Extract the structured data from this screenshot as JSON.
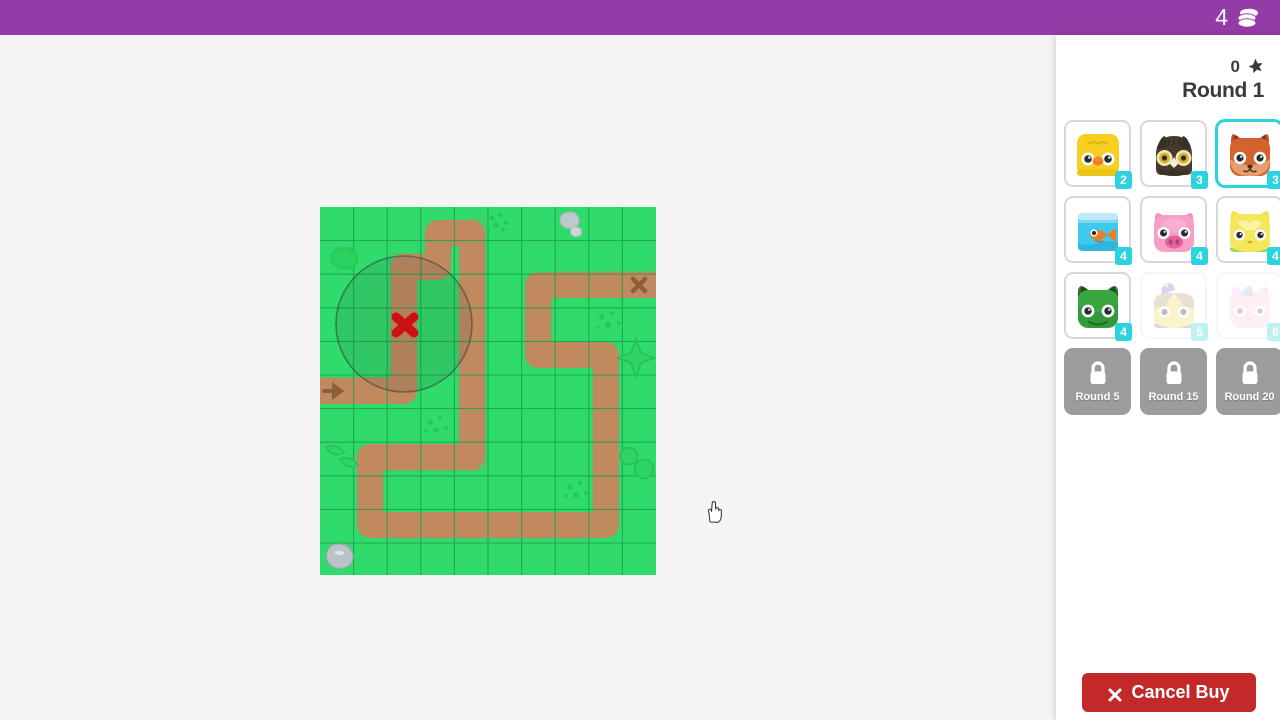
{
  "topbar": {
    "coins": "4",
    "coin_icon": "coin-stack-icon"
  },
  "sidebar": {
    "score": "0",
    "score_icon": "star-icon",
    "round_label": "Round 1",
    "towers": [
      {
        "name": "chick",
        "cost": "2",
        "selected": false,
        "affordable": true,
        "locked": false
      },
      {
        "name": "owl",
        "cost": "3",
        "selected": false,
        "affordable": true,
        "locked": false
      },
      {
        "name": "fox",
        "cost": "3",
        "selected": true,
        "affordable": true,
        "locked": false
      },
      {
        "name": "fish",
        "cost": "4",
        "selected": false,
        "affordable": true,
        "locked": false
      },
      {
        "name": "pig",
        "cost": "4",
        "selected": false,
        "affordable": true,
        "locked": false
      },
      {
        "name": "cat",
        "cost": "4",
        "selected": false,
        "affordable": true,
        "locked": false
      },
      {
        "name": "frog",
        "cost": "4",
        "selected": false,
        "affordable": true,
        "locked": false
      },
      {
        "name": "wizard",
        "cost": "5",
        "selected": false,
        "affordable": false,
        "locked": false
      },
      {
        "name": "unicorn",
        "cost": "6",
        "selected": false,
        "affordable": false,
        "locked": false
      }
    ],
    "locked_slots": [
      {
        "label": "Round 5",
        "icon": "lock-icon"
      },
      {
        "label": "Round 15",
        "icon": "lock-icon"
      },
      {
        "label": "Round 20",
        "icon": "lock-icon"
      }
    ],
    "cancel_button": {
      "label": "Cancel Buy",
      "icon": "close-x-icon",
      "color": "#c32929"
    }
  },
  "map": {
    "grass_color": "#2fdc6b",
    "path_color": "#c08a5e",
    "grid_line_color": "#1f9e4b",
    "cols": 10,
    "rows": 11,
    "cell": 33.6,
    "entrance_marker": "arrow-right-icon",
    "exit_marker": "exit-x-icon",
    "placement": {
      "valid": false,
      "marker": "invalid-placement-x-icon",
      "cursor": "pointer-hand-cursor",
      "range_center_x": 404,
      "range_center_y": 324,
      "range_radius": 68,
      "range_color": "#3a3a3a"
    },
    "decorations": [
      {
        "kind": "bush",
        "col": 0,
        "row": 1
      },
      {
        "kind": "pebbles",
        "col": 5,
        "row": 0
      },
      {
        "kind": "rocks",
        "col": 7,
        "row": 0
      },
      {
        "kind": "pebbles",
        "col": 8,
        "row": 3
      },
      {
        "kind": "star",
        "col": 9,
        "row": 4
      },
      {
        "kind": "pebbles",
        "col": 3,
        "row": 6
      },
      {
        "kind": "leaves",
        "col": 0,
        "row": 7
      },
      {
        "kind": "circles",
        "col": 9,
        "row": 7
      },
      {
        "kind": "pebbles",
        "col": 7,
        "row": 8
      },
      {
        "kind": "rock",
        "col": 0,
        "row": 10
      }
    ]
  }
}
